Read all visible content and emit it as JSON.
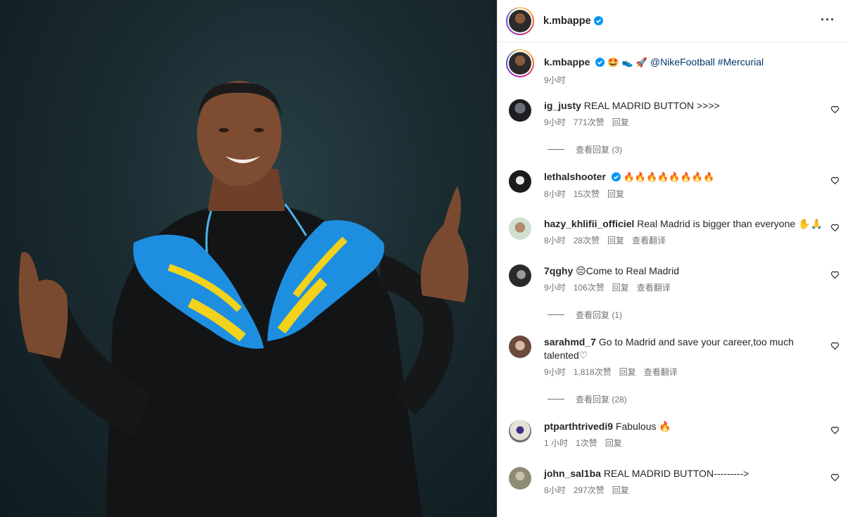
{
  "post": {
    "author": "k.mbappe",
    "more_icon": "more-horizontal-icon",
    "caption_emojis": "🤩 👟 🚀",
    "caption_mention": "@NikeFootball",
    "caption_hashtag": "#Mercurial",
    "time": "9小时"
  },
  "comments": [
    {
      "user": "ig_justy",
      "verified": false,
      "text": "REAL MADRID BUTTON >>>>",
      "time": "9小时",
      "likes": "771次赞",
      "reply": "回复",
      "translate": "",
      "view_replies": "查看回复 (3)"
    },
    {
      "user": "lethalshooter",
      "verified": true,
      "text": "🔥🔥🔥🔥🔥🔥🔥🔥",
      "time": "8小时",
      "likes": "15次赞",
      "reply": "回复",
      "translate": "",
      "view_replies": ""
    },
    {
      "user": "hazy_khlifii_officiel",
      "verified": false,
      "text": "Real Madrid is bigger than everyone ✋🙏",
      "time": "8小时",
      "likes": "28次赞",
      "reply": "回复",
      "translate": "查看翻译",
      "view_replies": ""
    },
    {
      "user": "7qghy",
      "verified": false,
      "text": "😔Come to Real Madrid",
      "time": "9小时",
      "likes": "106次赞",
      "reply": "回复",
      "translate": "查看翻译",
      "view_replies": "查看回复 (1)"
    },
    {
      "user": "sarahmd_7",
      "verified": false,
      "text": "Go to Madrid and save your career,too much talented♡",
      "time": "9小时",
      "likes": "1,818次赞",
      "reply": "回复",
      "translate": "查看翻译",
      "view_replies": "查看回复 (28)"
    },
    {
      "user": "ptparthtrivedi9",
      "verified": false,
      "text": "Fabulous 🔥",
      "time": "1 小时",
      "likes": "1次赞",
      "reply": "回复",
      "translate": "",
      "view_replies": ""
    },
    {
      "user": "john_sal1ba",
      "verified": false,
      "text": "REAL MADRID BUTTON--------->",
      "time": "8小时",
      "likes": "297次赞",
      "reply": "回复",
      "translate": "",
      "view_replies": ""
    }
  ],
  "icons": {
    "verified": "verified-badge-icon",
    "like": "heart-outline-icon"
  },
  "colors": {
    "verified": "#0095f6",
    "link": "#00376b",
    "secondary_text": "#737373",
    "shoe_blue": "#1e8fe0",
    "shoe_yellow": "#f2d21b"
  }
}
